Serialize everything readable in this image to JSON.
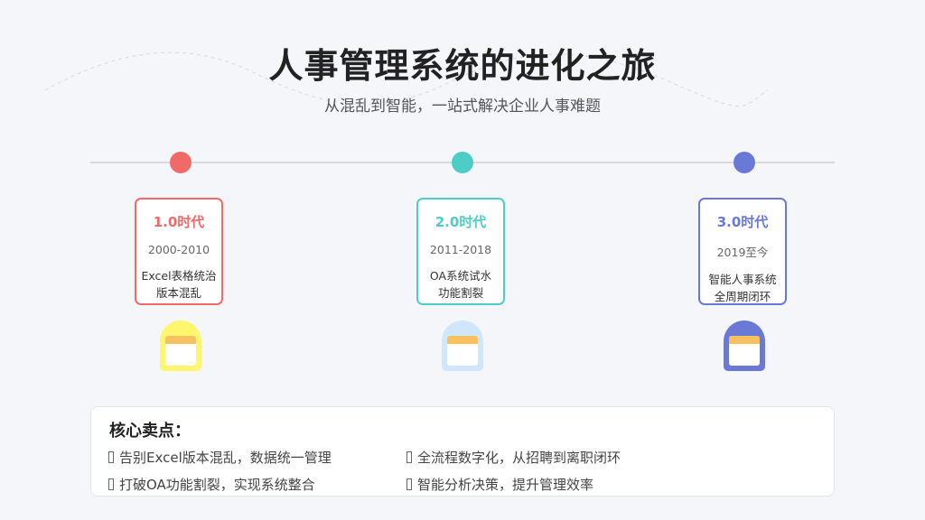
{
  "header": {
    "title": "人事管理系统的进化之旅",
    "subtitle": "从混乱到智能，一站式解决企业人事难题"
  },
  "timeline": [
    {
      "era": "1.0时代",
      "years": "2000-2010",
      "desc_line1": "Excel表格统治",
      "desc_line2": "版本混乱",
      "color": "#f06a6a",
      "icon": "document-icon",
      "icon_color": "#fff56e"
    },
    {
      "era": "2.0时代",
      "years": "2011-2018",
      "desc_line1": "OA系统试水",
      "desc_line2": "功能割裂",
      "color": "#4ecdc4",
      "icon": "document-icon",
      "icon_color": "#cfe6fb"
    },
    {
      "era": "3.0时代",
      "years": "2019至今",
      "desc_line1": "智能人事系统",
      "desc_line2": "全周期闭环",
      "color": "#6b79d6",
      "icon": "document-icon",
      "icon_color": "#6b79d6"
    }
  ],
  "selling_points": {
    "title": "核心卖点：",
    "items": [
      "告别Excel版本混乱，数据统一管理",
      "全流程数字化，从招聘到离职闭环",
      "打破OA功能割裂，实现系统整合",
      "智能分析决策，提升管理效率"
    ]
  }
}
